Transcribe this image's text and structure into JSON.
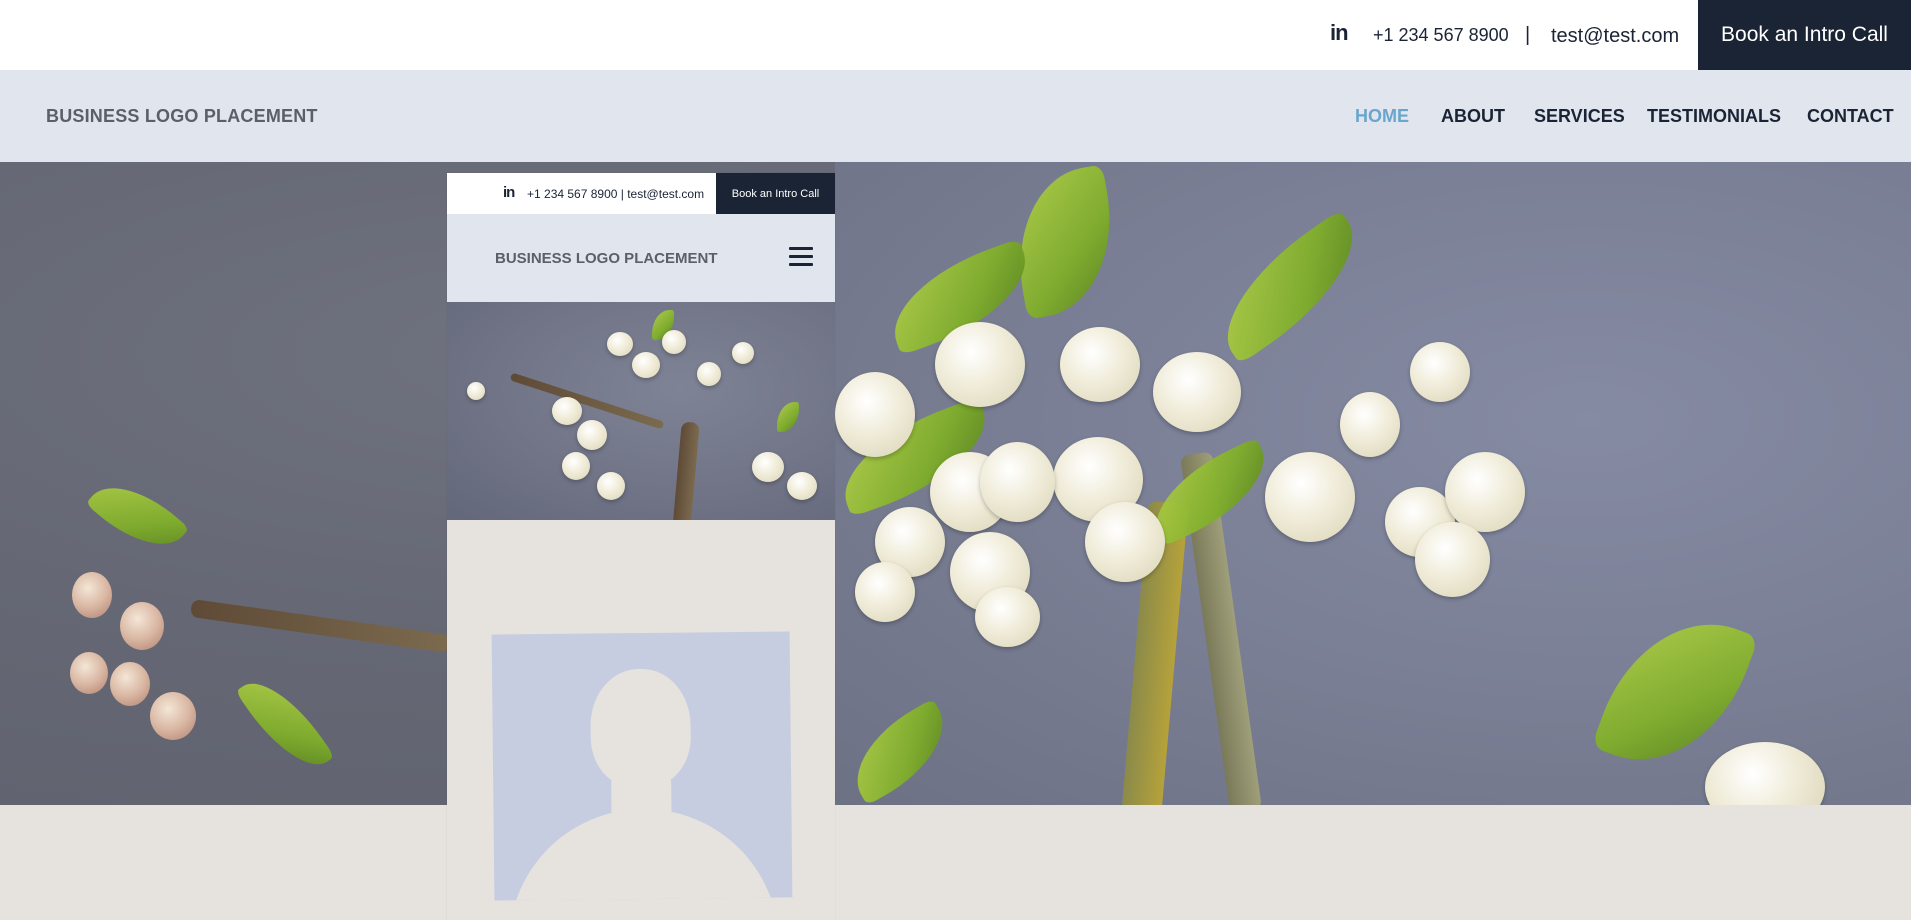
{
  "topbar": {
    "linkedin_icon": "in",
    "phone": "+1 234 567 8900",
    "separator": "|",
    "email": "test@test.com",
    "cta_label": "Book an Intro Call"
  },
  "header": {
    "logo": "BUSINESS LOGO PLACEMENT",
    "nav": [
      {
        "label": "HOME",
        "active": true
      },
      {
        "label": "ABOUT"
      },
      {
        "label": "SERVICES"
      },
      {
        "label": "TESTIMONIALS"
      },
      {
        "label": "CONTACT"
      }
    ]
  },
  "mobile_preview": {
    "linkedin_icon": "in",
    "contact_line": "+1 234 567 8900 | test@test.com",
    "cta_label": "Book an Intro Call",
    "logo": "BUSINESS LOGO PLACEMENT",
    "menu_icon": "hamburger-icon",
    "avatar_icon": "person-silhouette-icon"
  },
  "colors": {
    "navy": "#1b2434",
    "nav_bg": "#e0e5ee",
    "active_link": "#6aa6cc",
    "beige": "#e6e3de",
    "avatar_bg": "#c7cde0"
  },
  "hero": {
    "image": "blossom-branch-photo"
  }
}
